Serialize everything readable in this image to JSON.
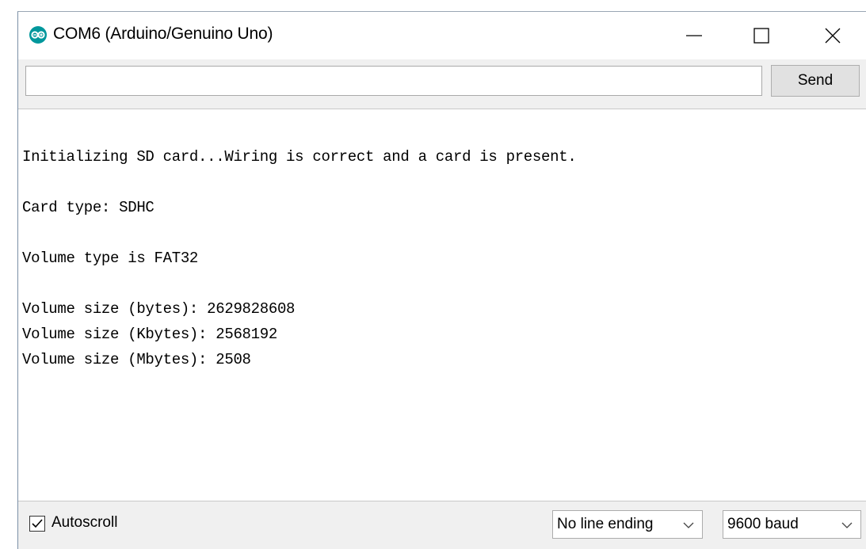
{
  "window": {
    "title": "COM6 (Arduino/Genuino Uno)",
    "icon": "arduino-infinity-icon",
    "accent_color": "#00979c"
  },
  "send_row": {
    "input_value": "",
    "send_label": "Send"
  },
  "output": {
    "lines": [
      "Initializing SD card...Wiring is correct and a card is present.",
      "Card type: SDHC",
      "Volume type is FAT32",
      "Volume size (bytes): 2629828608",
      "Volume size (Kbytes): 2568192",
      "Volume size (Mbytes): 2508"
    ]
  },
  "statusbar": {
    "autoscroll_label": "Autoscroll",
    "autoscroll_checked": true,
    "line_ending": "No line ending",
    "baud_rate": "9600 baud"
  }
}
